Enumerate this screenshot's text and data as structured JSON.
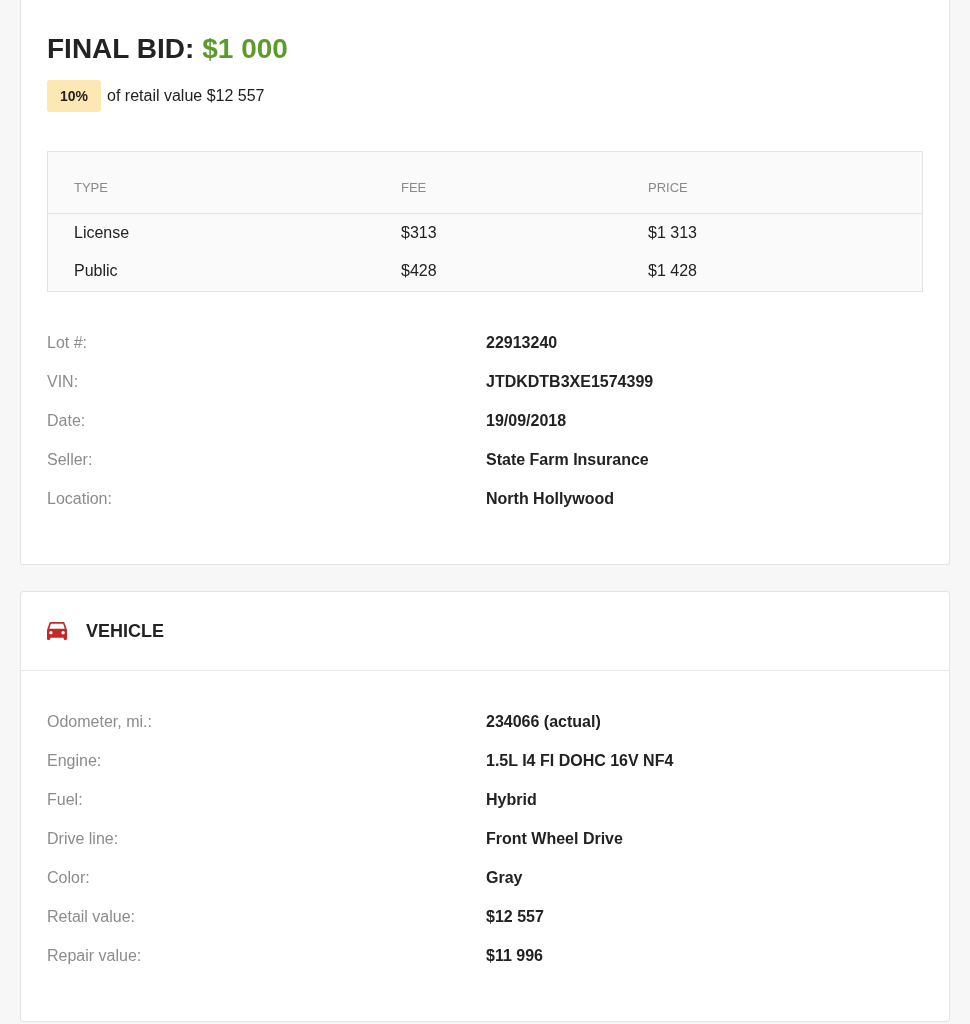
{
  "summary": {
    "title": "FINAL BID:",
    "amount": "$1 000",
    "badge": "10%",
    "badge_note": "of retail value $12 557"
  },
  "fees_table": {
    "columns": [
      "TYPE",
      "FEE",
      "PRICE"
    ],
    "rows": [
      [
        "License",
        "$313",
        "$1 313"
      ],
      [
        "Public",
        "$428",
        "$1 428"
      ]
    ]
  },
  "lot_details": [
    {
      "label": "Lot #:",
      "value": "22913240"
    },
    {
      "label": "VIN:",
      "value": "JTDKDTB3XE1574399"
    },
    {
      "label": "Date:",
      "value": "19/09/2018"
    },
    {
      "label": "Seller:",
      "value": "State Farm Insurance"
    },
    {
      "label": "Location:",
      "value": "North Hollywood"
    }
  ],
  "vehicle": {
    "title": "VEHICLE",
    "details": [
      {
        "label": "Odometer, mi.:",
        "value": "234066 (actual)"
      },
      {
        "label": "Engine:",
        "value": "1.5L I4 FI DOHC 16V NF4"
      },
      {
        "label": "Fuel:",
        "value": "Hybrid"
      },
      {
        "label": "Drive line:",
        "value": "Front Wheel Drive"
      },
      {
        "label": "Color:",
        "value": "Gray"
      },
      {
        "label": "Retail value:",
        "value": "$12 557"
      },
      {
        "label": "Repair value:",
        "value": "$11 996"
      }
    ]
  }
}
